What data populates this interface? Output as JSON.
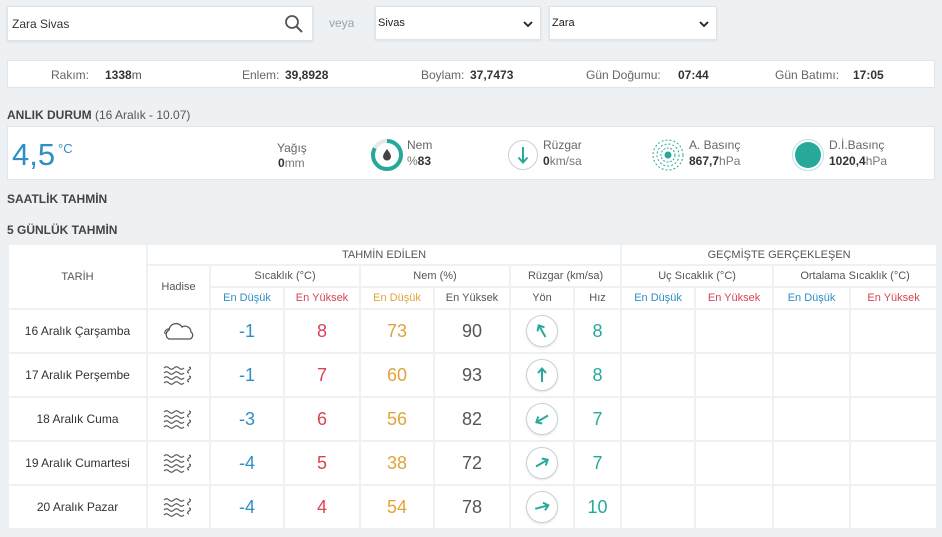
{
  "search": {
    "value": "Zara Sivas",
    "or_label": "veya"
  },
  "selects": {
    "city": "Sivas",
    "district": "Zara"
  },
  "location": {
    "altitude_label": "Rakım:",
    "altitude_value": "1338",
    "altitude_unit": "m",
    "lat_label": "Enlem:",
    "lat_value": "39,8928",
    "lon_label": "Boylam:",
    "lon_value": "37,7473",
    "sunrise_label": "Gün Doğumu:",
    "sunrise_value": "07:44",
    "sunset_label": "Gün Batımı:",
    "sunset_value": "17:05"
  },
  "current": {
    "title": "ANLIK DURUM",
    "subtitle": "(16 Aralık - 10.07)",
    "temp": "4,5",
    "temp_unit": "°C",
    "precip_label": "Yağış",
    "precip_value": "0",
    "precip_unit": "mm",
    "humidity_label": "Nem",
    "humidity_prefix": "%",
    "humidity_value": "83",
    "wind_label": "Rüzgar",
    "wind_value": "0",
    "wind_unit": "km/sa",
    "pressure_label": "A. Basınç",
    "pressure_value": "867,7",
    "pressure_unit": "hPa",
    "sea_pressure_label": "D.İ.Basınç",
    "sea_pressure_value": "1020,4",
    "sea_pressure_unit": "hPa"
  },
  "hourly_title": "SAATLİK TAHMİN",
  "daily_title": "5 GÜNLÜK TAHMİN",
  "table": {
    "predicted_header": "TAHMİN EDİLEN",
    "observed_header": "GEÇMİŞTE GERÇEKLEŞEN",
    "date_header": "TARİH",
    "event_header": "Hadise",
    "temp_header": "Sıcaklık (°C)",
    "humidity_header": "Nem (%)",
    "wind_header": "Rüzgar (km/sa)",
    "extreme_temp_header": "Uç Sıcaklık (°C)",
    "avg_temp_header": "Ortalama Sıcaklık (°C)",
    "min_label": "En Düşük",
    "max_label": "En Yüksek",
    "dir_label": "Yön",
    "speed_label": "Hız"
  },
  "forecast": [
    {
      "date": "16 Aralık Çarşamba",
      "event_icon": "cloud-icon",
      "temp_min": "-1",
      "temp_max": "8",
      "hum_min": "73",
      "hum_max": "90",
      "wind_dir_deg": 150,
      "wind_speed": "8"
    },
    {
      "date": "17 Aralık Perşembe",
      "event_icon": "fog-icon",
      "temp_min": "-1",
      "temp_max": "7",
      "hum_min": "60",
      "hum_max": "93",
      "wind_dir_deg": 180,
      "wind_speed": "8"
    },
    {
      "date": "18 Aralık Cuma",
      "event_icon": "fog-icon",
      "temp_min": "-3",
      "temp_max": "6",
      "hum_min": "56",
      "hum_max": "82",
      "wind_dir_deg": 60,
      "wind_speed": "7"
    },
    {
      "date": "19 Aralık Cumartesi",
      "event_icon": "fog-icon",
      "temp_min": "-4",
      "temp_max": "5",
      "hum_min": "38",
      "hum_max": "72",
      "wind_dir_deg": 240,
      "wind_speed": "7"
    },
    {
      "date": "20 Aralık Pazar",
      "event_icon": "fog-icon",
      "temp_min": "-4",
      "temp_max": "4",
      "hum_min": "54",
      "hum_max": "78",
      "wind_dir_deg": 255,
      "wind_speed": "10"
    }
  ],
  "colors": {
    "blue": "#2e8fc4",
    "red": "#d94354",
    "orange": "#e2a33b",
    "teal": "#27a99a"
  }
}
